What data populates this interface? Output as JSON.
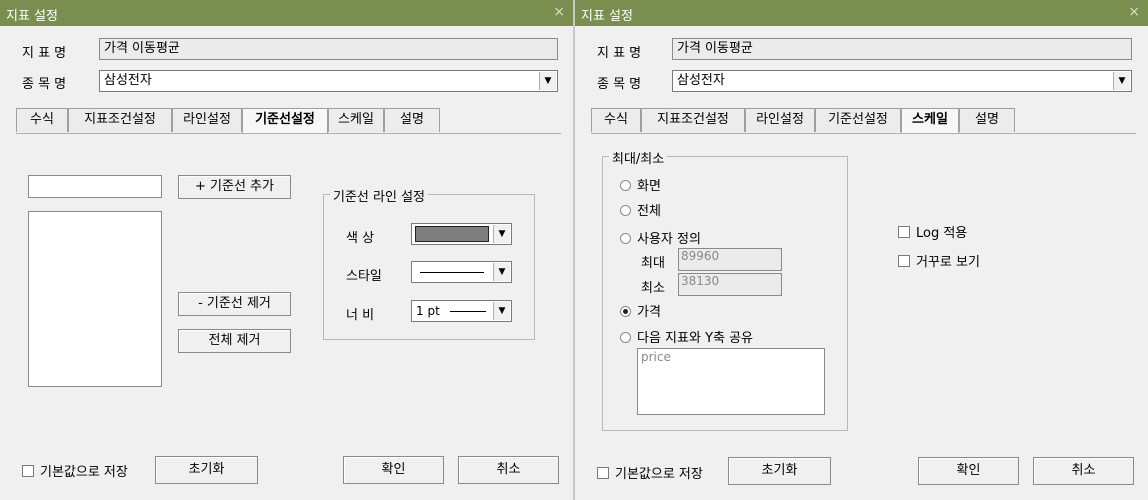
{
  "common": {
    "window_title": "지표 설정",
    "indicator_label": "지 표 명",
    "indicator_value": "가격 이동평균",
    "symbol_label": "종 목 명",
    "symbol_value": "삼성전자",
    "save_default_label": "기본값으로 저장",
    "reset_label": "초기화",
    "ok_label": "확인",
    "cancel_label": "취소",
    "close_glyph": "×",
    "dropdown_glyph": "▼"
  },
  "tabs": [
    "수식",
    "지표조건설정",
    "라인설정",
    "기준선설정",
    "스케일",
    "설명"
  ],
  "left": {
    "active_tab": "기준선설정",
    "add_button": "+ 기준선 추가",
    "remove_button": "- 기준선 제거",
    "clear_button": "전체 제거",
    "line_group_title": "기준선 라인 설정",
    "color_label": "색  상",
    "style_label": "스타일",
    "width_label": "너  비",
    "width_value": "1 pt",
    "swatch_color": "#7f7f7f"
  },
  "right": {
    "active_tab": "스케일",
    "minmax_group_title": "최대/최소",
    "options": {
      "screen": "화면",
      "all": "전체",
      "user": "사용자 정의",
      "price": "가격",
      "share_y": "다음 지표와 Y축 공유"
    },
    "selected_option": "price",
    "max_label": "최대",
    "max_value": "89960",
    "min_label": "최소",
    "min_value": "38130",
    "share_list_item": "price",
    "log_label": "Log 적용",
    "reverse_label": "거꾸로 보기"
  },
  "colors": {
    "titlebar": "#7a8f4f",
    "background": "#f0f0f0"
  }
}
